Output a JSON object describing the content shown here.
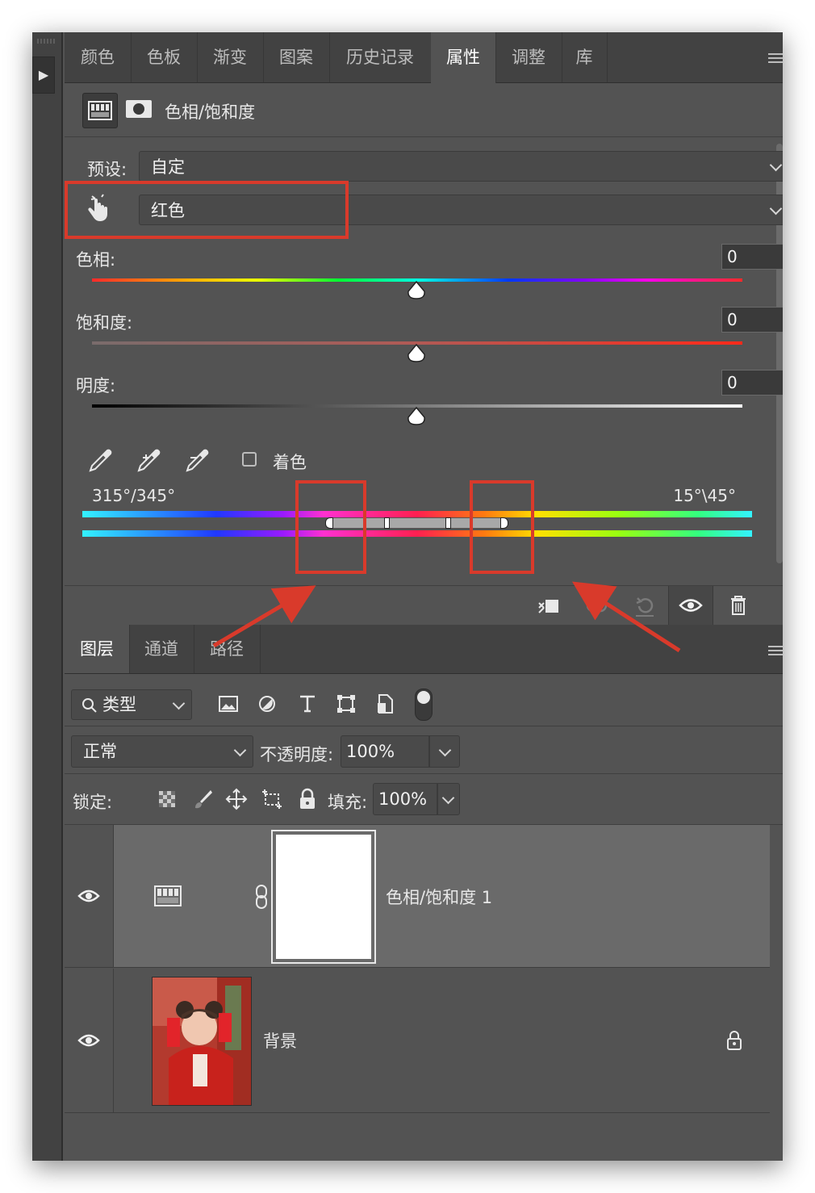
{
  "left_strip": {
    "expand_icon": "play-triangle-icon"
  },
  "tabs": {
    "items": [
      {
        "label": "颜色"
      },
      {
        "label": "色板"
      },
      {
        "label": "渐变"
      },
      {
        "label": "图案"
      },
      {
        "label": "历史记录"
      },
      {
        "label": "属性"
      },
      {
        "label": "调整"
      },
      {
        "label": "库"
      }
    ],
    "active": "属性"
  },
  "properties": {
    "title": "色相/饱和度",
    "preset_label": "预设:",
    "preset_value": "自定",
    "channel_value": "红色",
    "hue_label": "色相:",
    "hue_value": "0",
    "saturation_label": "饱和度:",
    "saturation_value": "0",
    "lightness_label": "明度:",
    "lightness_value": "0",
    "colorize_label": "着色",
    "colorize_checked": false,
    "range_left": "315°/345°",
    "range_right": "15°\\45°"
  },
  "layers_tabs": {
    "items": [
      {
        "label": "图层"
      },
      {
        "label": "通道"
      },
      {
        "label": "路径"
      }
    ],
    "active": "图层"
  },
  "layers": {
    "filter_value": "类型",
    "blend_mode": "正常",
    "opacity_label": "不透明度:",
    "opacity_value": "100%",
    "lock_label": "锁定:",
    "fill_label": "填充:",
    "fill_value": "100%",
    "rows": [
      {
        "name": "色相/饱和度 1",
        "visible": true,
        "selected": true
      },
      {
        "name": "背景",
        "visible": true,
        "locked": true
      }
    ]
  },
  "colors": {
    "annotation_red": "#d93a2b",
    "panel_bg": "#535353",
    "tab_bg": "#424242"
  }
}
